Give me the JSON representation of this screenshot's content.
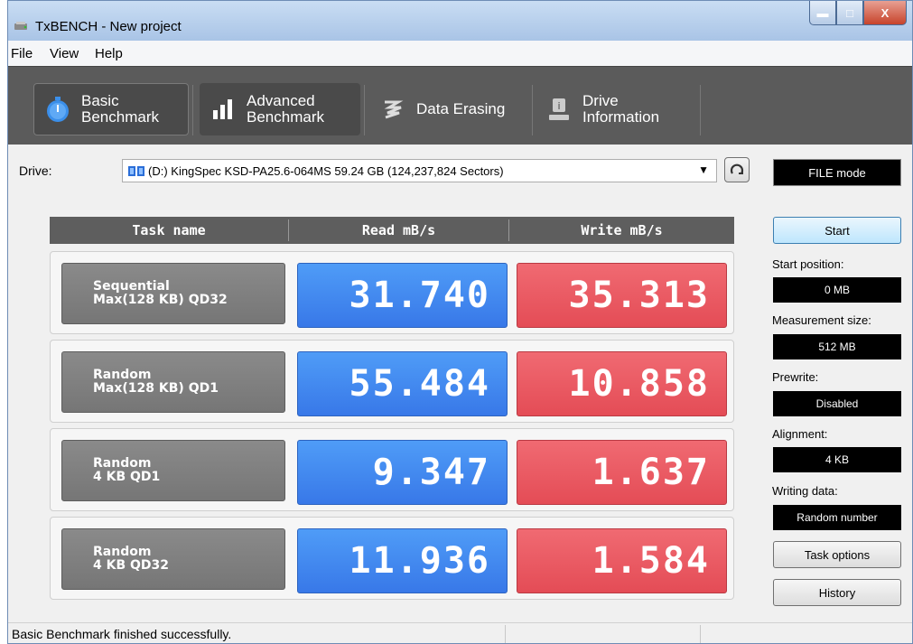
{
  "window": {
    "title": "TxBENCH - New project"
  },
  "menu": [
    "File",
    "View",
    "Help"
  ],
  "toolbar": {
    "basic": {
      "line1": "Basic",
      "line2": "Benchmark"
    },
    "advanced": {
      "line1": "Advanced",
      "line2": "Benchmark"
    },
    "erasing": {
      "label": "Data Erasing"
    },
    "info": {
      "line1": "Drive",
      "line2": "Information"
    }
  },
  "drive": {
    "label": "Drive:",
    "selected": "(D:) KingSpec KSD-PA25.6-064MS  59.24 GB (124,237,824 Sectors)",
    "mode": "FILE mode"
  },
  "table": {
    "headers": {
      "task": "Task name",
      "read": "Read mB/s",
      "write": "Write mB/s"
    },
    "rows": [
      {
        "line1": "Sequential",
        "line2": "Max(128 KB) QD32",
        "read": "31.740",
        "write": "35.313"
      },
      {
        "line1": "Random",
        "line2": "Max(128 KB) QD1",
        "read": "55.484",
        "write": "10.858"
      },
      {
        "line1": "Random",
        "line2": "4 KB QD1",
        "read": "9.347",
        "write": "1.637"
      },
      {
        "line1": "Random",
        "line2": "4 KB QD32",
        "read": "11.936",
        "write": "1.584"
      }
    ]
  },
  "side": {
    "start": "Start",
    "start_position_label": "Start position:",
    "start_position": "0 MB",
    "measurement_size_label": "Measurement size:",
    "measurement_size": "512 MB",
    "prewrite_label": "Prewrite:",
    "prewrite": "Disabled",
    "alignment_label": "Alignment:",
    "alignment": "4 KB",
    "writing_data_label": "Writing data:",
    "writing_data": "Random number",
    "task_options": "Task options",
    "history": "History"
  },
  "status": {
    "text": "Basic Benchmark finished successfully."
  },
  "colors": {
    "read": "#3d82ee",
    "write": "#e9535d",
    "toolbar": "#5b5b5b"
  }
}
